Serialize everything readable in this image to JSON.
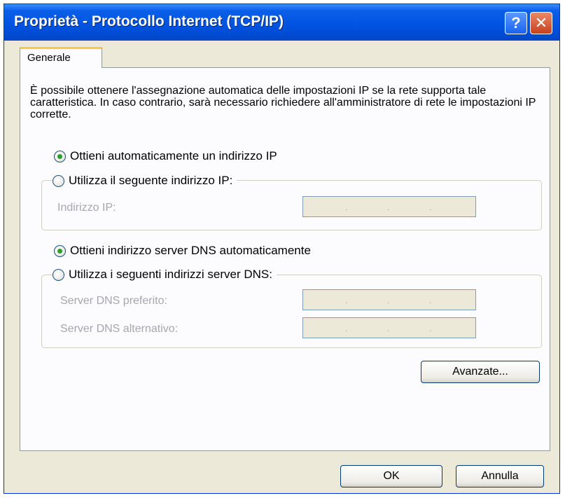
{
  "window": {
    "title": "Proprietà - Protocollo Internet (TCP/IP)",
    "help_glyph": "?",
    "close_glyph": "✕"
  },
  "tabs": [
    {
      "label": "Generale",
      "selected": true
    }
  ],
  "description": "È possibile ottenere l'assegnazione automatica delle impostazioni IP se la rete supporta tale caratteristica. In caso contrario, sarà necessario richiedere all'amministratore di rete le impostazioni IP corrette.",
  "ip": {
    "auto_label": "Ottieni automaticamente un indirizzo IP",
    "auto_selected": true,
    "manual_label": "Utilizza il seguente indirizzo IP:",
    "manual_selected": false,
    "address_label": "Indirizzo IP:",
    "address_value": ""
  },
  "dns": {
    "auto_label": "Ottieni indirizzo server DNS automaticamente",
    "auto_selected": true,
    "manual_label": "Utilizza i seguenti indirizzi server DNS:",
    "manual_selected": false,
    "preferred_label": "Server DNS preferito:",
    "alternate_label": "Server DNS alternativo:"
  },
  "buttons": {
    "advanced": "Avanzate...",
    "ok": "OK",
    "cancel": "Annulla"
  },
  "colors": {
    "titlebar": "#0053e0",
    "dialog_bg": "#ece9d8",
    "radio_dot": "#2aa02a",
    "tab_highlight": "#ffc83c"
  }
}
